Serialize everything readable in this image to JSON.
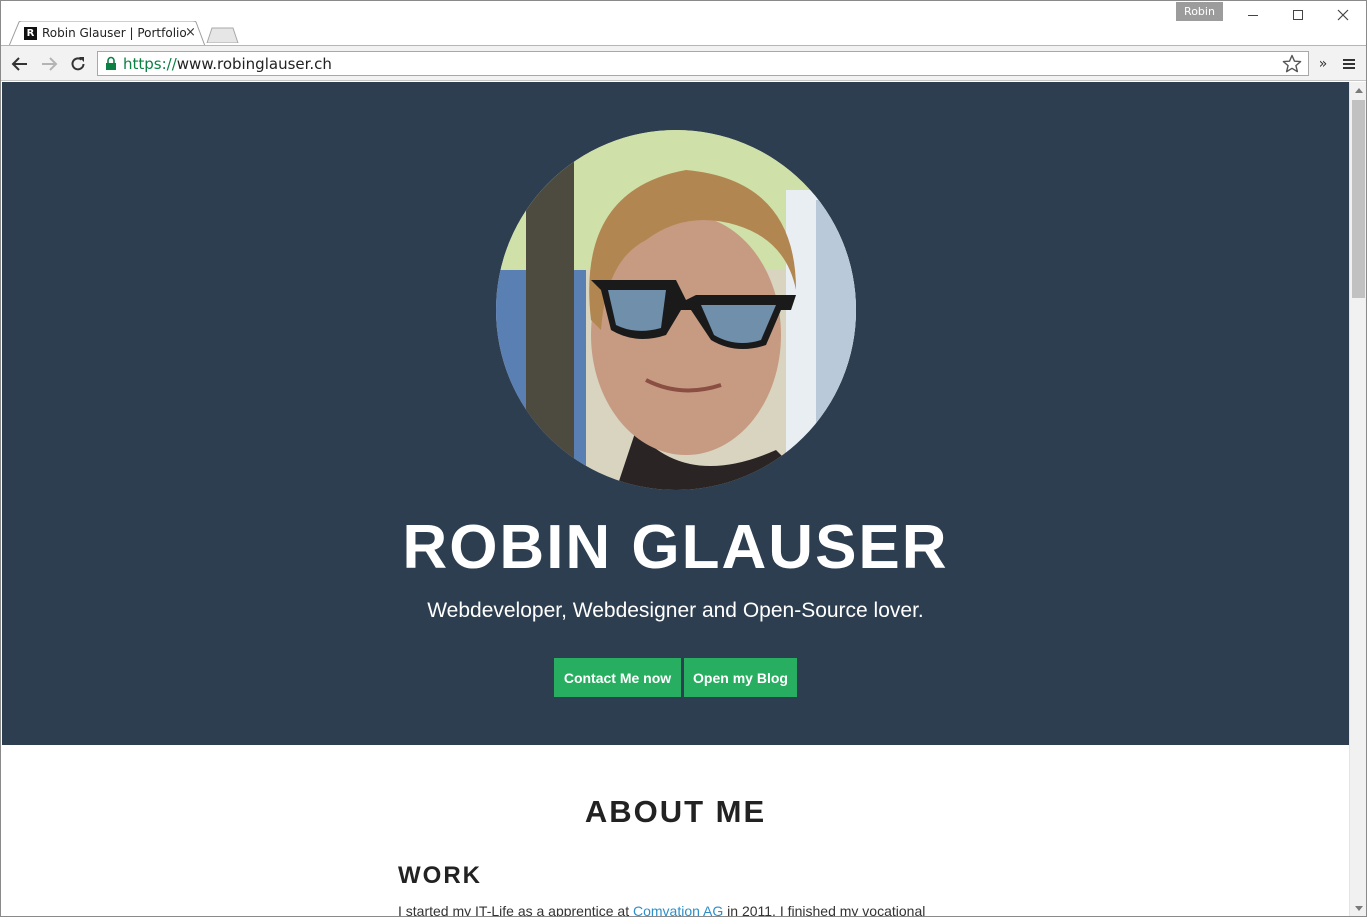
{
  "browser": {
    "profile_name": "Robin",
    "tab": {
      "favicon_letter": "R",
      "title": "Robin Glauser | Portfolio",
      "close_glyph": "×"
    },
    "address": {
      "scheme": "https://",
      "host": "www.robinglauser.ch"
    },
    "extensions_glyph": "»"
  },
  "hero": {
    "name": "ROBIN GLAUSER",
    "tagline": "Webdeveloper, Webdesigner and Open-Source lover.",
    "buttons": {
      "contact_label": "Contact Me now",
      "blog_label": "Open my Blog"
    }
  },
  "about": {
    "heading": "ABOUT ME",
    "work": {
      "heading": "WORK",
      "text_before": "I started my IT-Life as a apprentice at ",
      "link_text": "Comvation AG",
      "text_after": " in 2011. I finished my vocational"
    }
  },
  "colors": {
    "hero_bg": "#2c3e50",
    "button_bg": "#27ae60",
    "link": "#2c8fc9",
    "secure_scheme": "#0b8043"
  },
  "icons": {
    "back": "back-arrow-icon",
    "forward": "forward-arrow-icon",
    "reload": "reload-icon",
    "lock": "lock-icon",
    "bookmark": "star-icon",
    "menu": "hamburger-menu-icon"
  }
}
